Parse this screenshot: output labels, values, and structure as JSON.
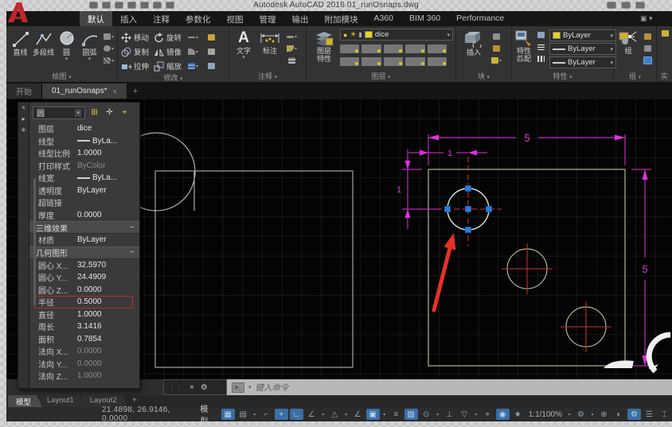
{
  "titlebar": {
    "title": "Autodesk AutoCAD 2016   01_runOsnaps.dwg",
    "qat_icons": [
      {
        "name": "workspace-icon"
      },
      {
        "name": "open-icon"
      },
      {
        "name": "save-icon"
      },
      {
        "name": "plot-icon"
      },
      {
        "name": "undo-icon"
      },
      {
        "name": "redo-icon"
      },
      {
        "name": "qat-dropdown-icon"
      }
    ],
    "right_icons": [
      {
        "name": "signin-icon"
      },
      {
        "name": "exchange-icon"
      },
      {
        "name": "help-icon"
      }
    ]
  },
  "ribbon": {
    "tabs": [
      {
        "label": "默认",
        "cls": "active"
      },
      {
        "label": "插入"
      },
      {
        "label": "注释"
      },
      {
        "label": "参数化"
      },
      {
        "label": "视图"
      },
      {
        "label": "管理"
      },
      {
        "label": "输出"
      },
      {
        "label": "附加模块"
      },
      {
        "label": "A360"
      },
      {
        "label": "BIM 360"
      },
      {
        "label": "Performance"
      }
    ],
    "draw": {
      "title": "绘图",
      "items": [
        "直线",
        "多段线",
        "圆",
        "圆弧"
      ]
    },
    "modify": {
      "title": "修改",
      "items": [
        "移动",
        "旋转",
        "复制",
        "镜像",
        "拉伸",
        "缩放"
      ]
    },
    "annotate": {
      "title": "注释",
      "items": [
        "文字",
        "标注"
      ]
    },
    "layers": {
      "title": "图层",
      "button_line1": "图层",
      "button_line2": "特性",
      "layer_name": "dice"
    },
    "block": {
      "title": "块",
      "insert_label": "插入"
    },
    "props": {
      "title": "特性",
      "match_line1": "特性",
      "match_line2": "匹配",
      "color_value": "ByLayer",
      "linetype_value": "ByLayer",
      "lineweight_value": "ByLayer"
    },
    "group": {
      "title": "组",
      "label": "组"
    },
    "util": {
      "title": "实"
    }
  },
  "file_tabs": {
    "start": "开始",
    "doc": "01_runOsnaps*",
    "close": "×",
    "add": "+"
  },
  "palette": {
    "selector": "圆",
    "rows_general": [
      {
        "label": "图层",
        "value": "dice"
      },
      {
        "label": "线型",
        "value": "ByLa...",
        "cls": "swatchline"
      },
      {
        "label": "线型比例",
        "value": "1.0000"
      },
      {
        "label": "打印样式",
        "value": "ByColor",
        "cls": "dim"
      },
      {
        "label": "线宽",
        "value": "ByLa...",
        "cls": "swatchline"
      },
      {
        "label": "透明度",
        "value": "ByLayer"
      },
      {
        "label": "超链接",
        "value": ""
      },
      {
        "label": "厚度",
        "value": "0.0000"
      }
    ],
    "section_3d": "三维效果",
    "rows_3d": [
      {
        "label": "材质",
        "value": "ByLayer"
      }
    ],
    "section_geo": "几何图形",
    "rows_geo": [
      {
        "label": "圆心 X...",
        "value": "32.5970"
      },
      {
        "label": "圆心 Y...",
        "value": "24.4909"
      },
      {
        "label": "圆心 Z...",
        "value": "0.0000"
      },
      {
        "label": "半径",
        "value": "0.5000",
        "cls": "hl"
      },
      {
        "label": "直径",
        "value": "1.0000"
      },
      {
        "label": "周长",
        "value": "3.1416"
      },
      {
        "label": "面积",
        "value": "0.7854"
      },
      {
        "label": "法向 X...",
        "value": "0.0000",
        "cls": "dim"
      },
      {
        "label": "法向 Y...",
        "value": "0.0000",
        "cls": "dim"
      },
      {
        "label": "法向 Z...",
        "value": "1.0000",
        "cls": "dim"
      }
    ]
  },
  "command_line": {
    "placeholder": "键入命令",
    "close": "×",
    "prompt": ">_"
  },
  "layout_tabs": [
    {
      "label": "模型",
      "cls": "active"
    },
    {
      "label": "Layout1"
    },
    {
      "label": "Layout2"
    }
  ],
  "status_bar": {
    "coordinates": "21.4898, 26.9146, 0.0000",
    "model_label": "模型",
    "scale": "1:1/100%",
    "icons": [
      {
        "g": "▦",
        "name": "grid-icon",
        "cls": "on"
      },
      {
        "g": "▤",
        "name": "snap-icon"
      },
      {
        "g": "▾",
        "name": "snap-dropdown-icon",
        "cls": "car"
      },
      {
        "g": "⌐",
        "name": "infer-constraints-icon"
      },
      {
        "g": "+",
        "name": "dynamic-input-icon",
        "cls": "on"
      },
      {
        "g": "∟",
        "name": "ortho-icon",
        "cls": "on"
      },
      {
        "g": "∠",
        "name": "polar-tracking-icon"
      },
      {
        "g": "▾",
        "name": "polar-dropdown-icon",
        "cls": "car"
      },
      {
        "g": "△",
        "name": "isodraft-icon"
      },
      {
        "g": "▾",
        "name": "isodraft-dropdown-icon",
        "cls": "car"
      },
      {
        "g": "∠",
        "name": "osnap-tracking-icon"
      },
      {
        "g": "▣",
        "name": "osnap-icon",
        "cls": "on"
      },
      {
        "g": "▾",
        "name": "osnap-dropdown-icon",
        "cls": "car"
      },
      {
        "g": "≡",
        "name": "lineweight-icon"
      },
      {
        "g": "▨",
        "name": "transparency-icon",
        "cls": "on"
      },
      {
        "g": "⊙",
        "name": "selection-cycling-icon"
      },
      {
        "g": "▾",
        "name": "cycling-dropdown-icon",
        "cls": "car"
      },
      {
        "g": "⊥",
        "name": "dynamic-ucs-icon"
      },
      {
        "g": "▽",
        "name": "selection-filter-icon"
      },
      {
        "g": "▾",
        "name": "filter-dropdown-icon",
        "cls": "car"
      },
      {
        "g": "⌖",
        "name": "gizmo-icon"
      },
      {
        "g": "◉",
        "name": "annotation-visibility-icon",
        "cls": "on"
      },
      {
        "g": "★",
        "name": "autoscale-icon"
      }
    ],
    "icons_right": [
      {
        "g": "▾",
        "name": "scale-dropdown-icon",
        "cls": "car"
      },
      {
        "g": "⚙",
        "name": "workspace-switch-icon"
      },
      {
        "g": "▾",
        "name": "workspace-dropdown-icon",
        "cls": "car"
      },
      {
        "g": "⊕",
        "name": "annotation-monitor-icon"
      },
      {
        "g": "◐",
        "name": "isolate-objects-icon"
      },
      {
        "g": "⚙",
        "name": "hardware-accel-icon",
        "cls": "on"
      },
      {
        "g": "☰",
        "name": "customize-icon"
      },
      {
        "g": "⌶",
        "name": "clean-screen-icon"
      }
    ]
  },
  "drawing": {
    "dim_top": "5",
    "dim_top_inner": "1",
    "dim_left": "1",
    "dim_right": "5"
  }
}
